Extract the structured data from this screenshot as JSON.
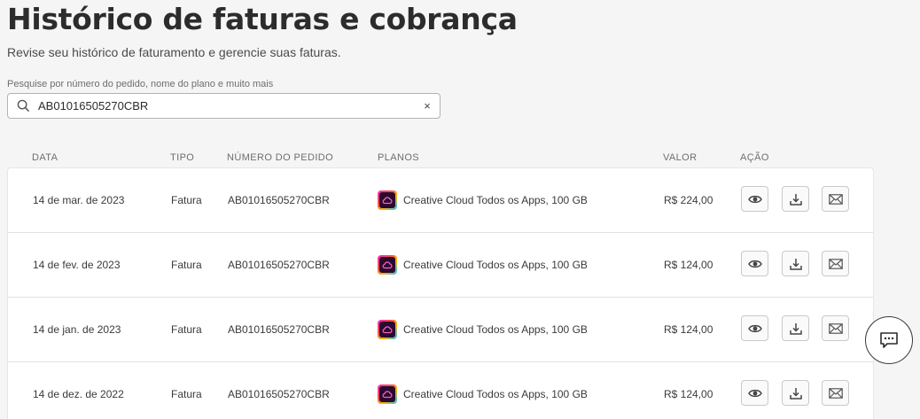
{
  "page": {
    "title": "Histórico de faturas e cobrança",
    "subtitle": "Revise seu histórico de faturamento e gerencie suas faturas."
  },
  "search": {
    "label": "Pesquise por número do pedido, nome do plano e muito mais",
    "value": "AB01016505270CBR",
    "clear_symbol": "×"
  },
  "table": {
    "headers": {
      "date": "DATA",
      "type": "TIPO",
      "order": "NÚMERO DO PEDIDO",
      "plans": "PLANOS",
      "value": "VALOR",
      "action": "AÇÃO"
    },
    "rows": [
      {
        "date": "14 de mar. de 2023",
        "type": "Fatura",
        "order": "AB01016505270CBR",
        "plan": "Creative Cloud Todos os Apps, 100 GB",
        "value": "R$ 224,00"
      },
      {
        "date": "14 de fev. de 2023",
        "type": "Fatura",
        "order": "AB01016505270CBR",
        "plan": "Creative Cloud Todos os Apps, 100 GB",
        "value": "R$ 124,00"
      },
      {
        "date": "14 de jan. de 2023",
        "type": "Fatura",
        "order": "AB01016505270CBR",
        "plan": "Creative Cloud Todos os Apps, 100 GB",
        "value": "R$ 124,00"
      },
      {
        "date": "14 de dez. de 2022",
        "type": "Fatura",
        "order": "AB01016505270CBR",
        "plan": "Creative Cloud Todos os Apps, 100 GB",
        "value": "R$ 124,00"
      }
    ],
    "actions": [
      "view-icon",
      "download-icon",
      "email-icon"
    ]
  },
  "chat": {
    "icon": "chat-icon"
  }
}
